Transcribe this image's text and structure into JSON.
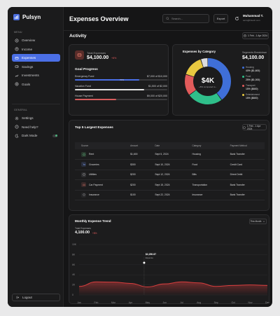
{
  "app": {
    "name": "Pulsyn"
  },
  "sidebar": {
    "menu_label": "MENU",
    "items": [
      {
        "label": "Overview",
        "icon": "grid-icon"
      },
      {
        "label": "Income",
        "icon": "income-icon"
      },
      {
        "label": "Expenses",
        "icon": "expenses-icon",
        "active": true
      },
      {
        "label": "Savings",
        "icon": "savings-icon"
      },
      {
        "label": "Investments",
        "icon": "investments-icon"
      },
      {
        "label": "Goals",
        "icon": "goals-icon"
      }
    ],
    "general_label": "GENERAL",
    "general_items": [
      {
        "label": "Settings",
        "icon": "gear-icon"
      },
      {
        "label": "Need help?",
        "icon": "help-icon"
      },
      {
        "label": "Dark Mode",
        "icon": "moon-icon",
        "toggle": true
      }
    ],
    "logout_label": "Logout"
  },
  "header": {
    "title": "Expenses Overview",
    "search_placeholder": "Search...",
    "export_label": "Export",
    "user_name": "Muhammad T.",
    "user_email": "asim@fintech.com"
  },
  "activity": {
    "title": "Activity",
    "date_range": "1 Feb - 1 Apr 2024"
  },
  "total_expenses": {
    "label": "Total Expenses",
    "value": "$4,100.00",
    "change": "+8%"
  },
  "goal_progress": {
    "title": "Goal Progress",
    "goals": [
      {
        "name": "Emergency Fund",
        "amount": "$7,000 of $10,000",
        "pct_label": "70%",
        "fraction": 0.7,
        "color": "#4b6fe6"
      },
      {
        "name": "Vacation Fund",
        "amount": "$1,500 of $2,000",
        "fraction": 0.75,
        "color": "#e6e6e6"
      },
      {
        "name": "House Payment",
        "amount": "$9,000 of $20,000",
        "fraction": 0.45,
        "color": "#d65d5d"
      }
    ]
  },
  "category": {
    "title": "Expenses by Category",
    "center_value": "$4K",
    "center_sub": "+8% compared to...",
    "breakdown_label": "Segments Breakdown",
    "breakdown_value": "$4,100.00",
    "segments": [
      {
        "name": "Housing",
        "value": "40% ($1,600)",
        "color": "#3f6fd8",
        "fraction": 0.4
      },
      {
        "name": "Food",
        "value": "25% ($1,000)",
        "color": "#2fbf8a",
        "fraction": 0.25
      },
      {
        "name": "Transport",
        "value": "15% ($600)",
        "color": "#e25b5b",
        "fraction": 0.15
      },
      {
        "name": "Entertainment",
        "value": "15% ($600)",
        "color": "#e8c840",
        "fraction": 0.15
      },
      {
        "name": "Utilities",
        "value": "5% ($200)",
        "color": "#dcdcde",
        "fraction": 0.05
      }
    ]
  },
  "largest": {
    "title": "Top 5 Largest Expenses",
    "date_range": "1 Feb - 1 Apr 2024",
    "columns": [
      "Source",
      "Amount",
      "Date",
      "Category",
      "Payment Method"
    ],
    "rows": [
      {
        "source": "Rent",
        "amount": "$1,600",
        "date": "Sept 5, 2024",
        "category": "Housing",
        "method": "Bank Transfer"
      },
      {
        "source": "Groceries",
        "amount": "$300",
        "date": "Sept 10, 2024",
        "category": "Food",
        "method": "Credit Card"
      },
      {
        "source": "Utilities",
        "amount": "$200",
        "date": "Sept 12, 2024",
        "category": "Bills",
        "method": "Direct Debit"
      },
      {
        "source": "Car Payment",
        "amount": "$200",
        "date": "Sept 15, 2024",
        "category": "Transportation",
        "method": "Bank Transfer"
      },
      {
        "source": "Insurance",
        "amount": "$100",
        "date": "Sept 22, 2024",
        "category": "Insurance",
        "method": "Bank Transfer"
      }
    ]
  },
  "trend": {
    "title": "Monthly Expense Trend",
    "period": "This Month",
    "total_label": "Total Expenses",
    "total_value": "4,100.00",
    "change": "+8%",
    "tooltip_value": "$2,250.87",
    "tooltip_label": "Expense"
  },
  "chart_data": {
    "type": "area",
    "title": "Monthly Expense Trend",
    "categories": [
      "Jan",
      "Feb",
      "Mar",
      "Apr",
      "May",
      "Jun",
      "Jul",
      "Aug",
      "Sep",
      "Oct",
      "Nov",
      "Dec"
    ],
    "series": [
      {
        "values": [
          1700,
          2600,
          2550,
          2300,
          1600,
          2200,
          2600,
          2400,
          1700,
          1900,
          2000,
          1900
        ]
      }
    ],
    "y_ticks": [
      "10K",
      "8K",
      "6K",
      "4K",
      "2K",
      "0"
    ],
    "ylim": [
      0,
      10000
    ],
    "color": "#d83e3e",
    "grid": true
  }
}
